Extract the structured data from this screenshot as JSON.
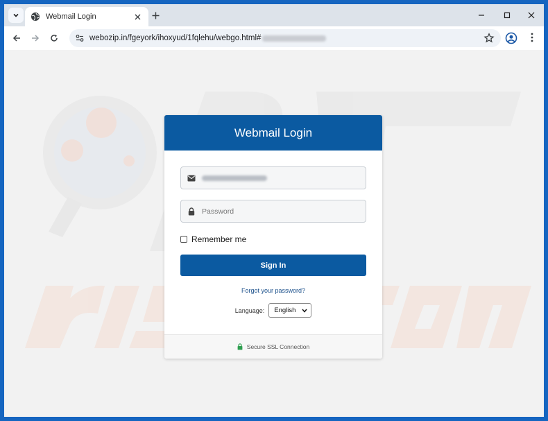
{
  "browser": {
    "tab": {
      "title": "Webmail Login"
    },
    "address": {
      "url": "webozip.in/fgeyork/ihoxyud/1fqlehu/webgo.html#"
    }
  },
  "login": {
    "title": "Webmail Login",
    "password_placeholder": "Password",
    "remember_label": "Remember me",
    "signin_label": "Sign In",
    "forgot_link": "Forgot your password?",
    "language_label": "Language:",
    "language_selected": "English",
    "footer_text": "Secure SSL Connection"
  },
  "colors": {
    "header_blue": "#0b5aa1",
    "ssl_lock_green": "#2e9e4f",
    "window_frame": "#1565c0"
  },
  "icons": {
    "tab_search": "chevron-down-icon",
    "favicon": "globe-icon",
    "email": "envelope-icon",
    "password": "lock-icon",
    "ssl": "lock-icon"
  }
}
